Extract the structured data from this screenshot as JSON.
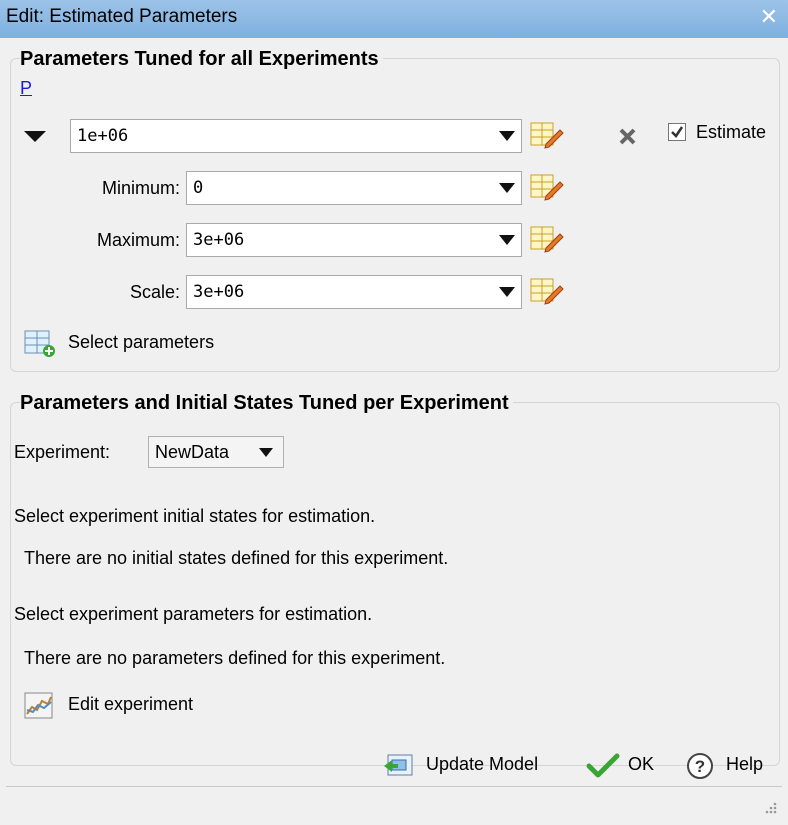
{
  "window": {
    "title": "Edit: Estimated Parameters",
    "close_glyph": "✕"
  },
  "panel_all": {
    "title": "Parameters Tuned for all Experiments",
    "param_link": "P",
    "value": "1e+06",
    "estimate_label": "Estimate",
    "estimate_checked": true,
    "minimum_label": "Minimum:",
    "minimum_value": "0",
    "maximum_label": "Maximum:",
    "maximum_value": "3e+06",
    "scale_label": "Scale:",
    "scale_value": "3e+06",
    "select_parameters_label": "Select parameters"
  },
  "panel_per": {
    "title": "Parameters and Initial States Tuned per Experiment",
    "experiment_label": "Experiment:",
    "experiment_value": "NewData",
    "states_heading": "Select experiment initial states for estimation.",
    "states_note": "There are no initial states defined for this experiment.",
    "params_heading": "Select experiment parameters for estimation.",
    "params_note": "There are no parameters defined for this experiment.",
    "edit_experiment_label": "Edit experiment"
  },
  "footer": {
    "update_model_label": "Update Model",
    "ok_label": "OK",
    "help_label": "Help"
  },
  "icons": {
    "edit": "edit-table-icon",
    "delete": "x-icon",
    "select": "add-grid-icon",
    "experiment": "experiment-icon",
    "update": "update-model-icon",
    "ok": "check-icon",
    "help": "help-icon"
  },
  "colors": {
    "link": "#1a1adc",
    "titlebar": "#8db9e4",
    "check": "#3aa535"
  }
}
